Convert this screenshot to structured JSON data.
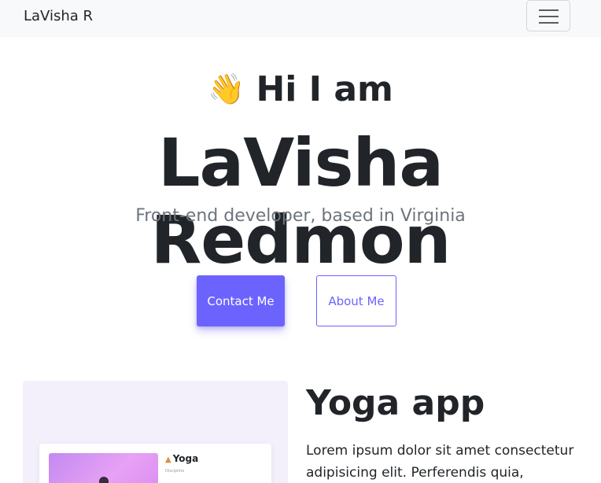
{
  "navbar": {
    "brand": "LaVisha R",
    "toggler_icon": "hamburger-menu-icon"
  },
  "hero": {
    "wave_icon": "👋",
    "greeting": "Hi I am",
    "name": "LaVisha Redmon",
    "tagline": "Front-end developer, based in Virginia"
  },
  "buttons": {
    "contact": "Contact Me",
    "about": "About Me"
  },
  "project": {
    "title": "Yoga app",
    "description": "Lorem ipsum dolor sit amet consectetur adipisicing elit. Perferendis quia,",
    "mockup_title": "Yoga",
    "mockup_sub": "Discipline"
  },
  "colors": {
    "accent": "#6c63ff",
    "navbar_bg": "#f8f9fa",
    "card_bg": "#f3f0fc",
    "muted_text": "#6c757d"
  }
}
